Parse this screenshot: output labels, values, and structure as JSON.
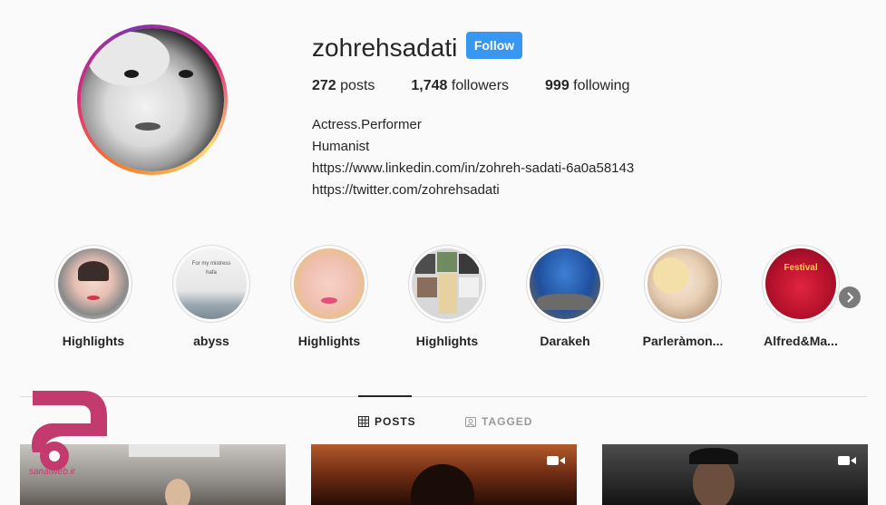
{
  "profile": {
    "username": "zohrehsadati",
    "follow_label": "Follow",
    "stats": {
      "posts_count": "272",
      "posts_label": " posts",
      "followers_count": "1,748",
      "followers_label": " followers",
      "following_count": "999",
      "following_label": " following"
    },
    "bio": {
      "line1": "Actress.Performer",
      "line2": "Humanist",
      "link1": "https://www.linkedin.com/in/zohreh-sadati-6a0a58143",
      "link2": "https://twitter.com/zohrehsadati"
    }
  },
  "highlights": [
    {
      "label": "Highlights"
    },
    {
      "label": "abyss"
    },
    {
      "label": "Highlights"
    },
    {
      "label": "Highlights"
    },
    {
      "label": "Darakeh"
    },
    {
      "label": "Parleràmon..."
    },
    {
      "label": "Alfred&Ma..."
    }
  ],
  "highlight_thumb_text": {
    "abyss_line1": "For my mistress",
    "abyss_line2": "hafa",
    "alfred_banner": "Festival"
  },
  "tabs": {
    "posts_label": "POSTS",
    "tagged_label": "TAGGED"
  },
  "watermark": {
    "text": "sanatweb.ir"
  },
  "colors": {
    "follow_blue": "#3897f0",
    "text": "#262626",
    "muted": "#999999",
    "watermark": "#c23a6e"
  }
}
